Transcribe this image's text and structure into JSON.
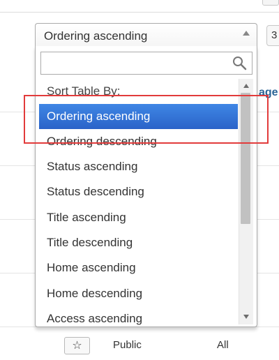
{
  "select": {
    "selected_label": "Ordering ascending",
    "search_value": ""
  },
  "dropdown": {
    "group_label": "Sort Table By:",
    "options": [
      "Ordering ascending",
      "Ordering descending",
      "Status ascending",
      "Status descending",
      "Title ascending",
      "Title descending",
      "Home ascending",
      "Home descending",
      "Access ascending"
    ],
    "highlighted_index": 0
  },
  "background": {
    "right_button_text": "3",
    "right_link_text": "age",
    "bottom_row": {
      "access": "Public",
      "language": "All"
    }
  },
  "colors": {
    "highlight": "#3875d7",
    "callout": "#e23b3b",
    "link": "#2a6496"
  },
  "icons": {
    "search": "search-icon",
    "select_arrow": "chevron-up-icon",
    "featured": "star-icon"
  }
}
